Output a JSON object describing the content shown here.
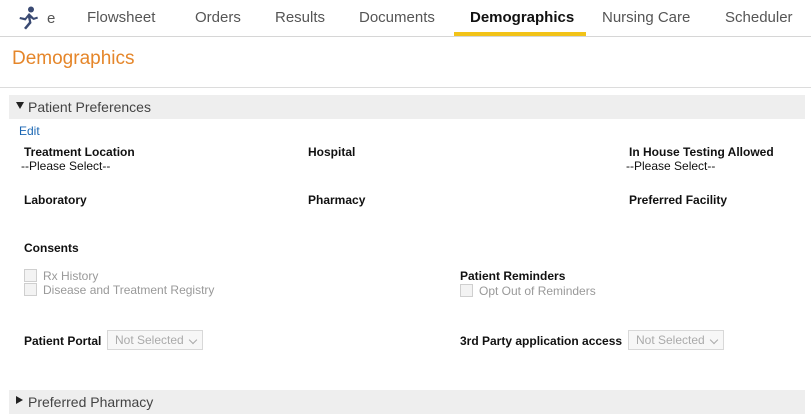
{
  "app": {
    "logo_letter": "e",
    "brand_color": "#e5862a",
    "accent_color": "#f2c318",
    "logo_icon": "running-figure-icon"
  },
  "tabs": [
    {
      "label": "Flowsheet",
      "active": false
    },
    {
      "label": "Orders",
      "active": false
    },
    {
      "label": "Results",
      "active": false
    },
    {
      "label": "Documents",
      "active": false
    },
    {
      "label": "Demographics",
      "active": true
    },
    {
      "label": "Nursing Care",
      "active": false
    },
    {
      "label": "Scheduler",
      "active": false
    }
  ],
  "page": {
    "title": "Demographics"
  },
  "patient_preferences": {
    "header": "Patient Preferences",
    "expanded": true,
    "edit_label": "Edit",
    "treatment_location": {
      "label": "Treatment Location",
      "value": "--Please Select--"
    },
    "hospital": {
      "label": "Hospital",
      "value": ""
    },
    "in_house_testing": {
      "label": "In House Testing Allowed",
      "value": "--Please Select--"
    },
    "laboratory": {
      "label": "Laboratory",
      "value": ""
    },
    "pharmacy": {
      "label": "Pharmacy",
      "value": ""
    },
    "preferred_facility": {
      "label": "Preferred Facility",
      "value": ""
    },
    "consents": {
      "label": "Consents",
      "items": [
        "Rx History",
        "Disease and Treatment Registry"
      ]
    },
    "patient_reminders": {
      "label": "Patient Reminders",
      "items": [
        "Opt Out of Reminders"
      ]
    },
    "patient_portal": {
      "label": "Patient Portal",
      "value": "Not Selected"
    },
    "third_party_access": {
      "label": "3rd Party application access",
      "value": "Not Selected"
    }
  },
  "preferred_pharmacy": {
    "header": "Preferred Pharmacy",
    "expanded": false
  }
}
